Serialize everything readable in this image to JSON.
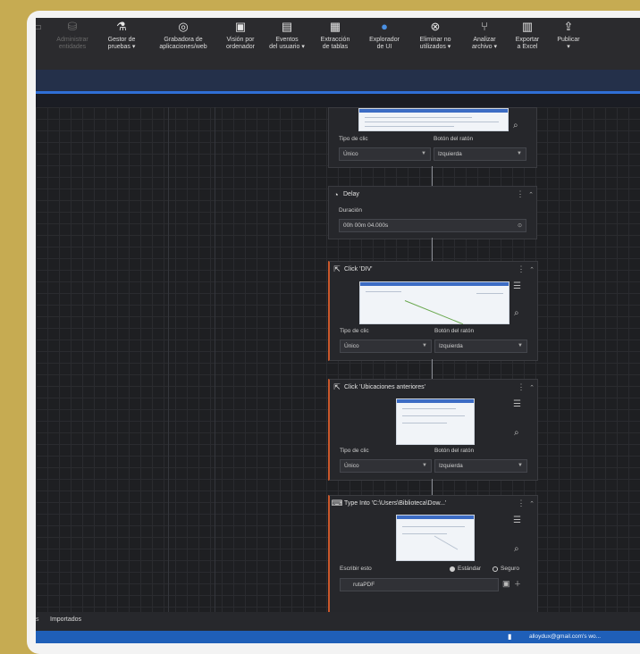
{
  "ribbon": {
    "items": [
      {
        "label1": "Administrar",
        "label2": "entidades",
        "icon": "database-icon",
        "enabled": false
      },
      {
        "label1": "Gestor de",
        "label2": "pruebas ▾",
        "icon": "flask-icon",
        "enabled": true
      },
      {
        "label1": "Grabadora de",
        "label2": "aplicaciones/web",
        "icon": "record-icon",
        "enabled": true
      },
      {
        "label1": "Visión por",
        "label2": "ordenador",
        "icon": "camera-icon",
        "enabled": true
      },
      {
        "label1": "Eventos",
        "label2": "del usuario ▾",
        "icon": "event-icon",
        "enabled": true
      },
      {
        "label1": "Extracción",
        "label2": "de tablas",
        "icon": "table-icon",
        "enabled": true
      },
      {
        "label1": "Explorador",
        "label2": "de UI",
        "icon": "globe-icon",
        "enabled": true
      },
      {
        "label1": "Eliminar no",
        "label2": "utilizados ▾",
        "icon": "remove-icon",
        "enabled": true
      },
      {
        "label1": "Analizar",
        "label2": "archivo ▾",
        "icon": "analyze-icon",
        "enabled": true
      },
      {
        "label1": "Exportar",
        "label2": "a Excel",
        "icon": "excel-icon",
        "enabled": true
      },
      {
        "label1": "Publicar",
        "label2": "▾",
        "icon": "upload-icon",
        "enabled": true
      }
    ]
  },
  "activities": {
    "click1": {
      "tipo_label": "Tipo de clic",
      "tipo_value": "Único",
      "boton_label": "Botón del ratón",
      "boton_value": "Izquierda"
    },
    "delay": {
      "title": "Delay",
      "duracion_label": "Duración",
      "duracion_value": "00h 00m 04.000s"
    },
    "click2": {
      "title": "Click 'DIV'",
      "tipo_label": "Tipo de clic",
      "tipo_value": "Único",
      "boton_label": "Botón del ratón",
      "boton_value": "Izquierda"
    },
    "click3": {
      "title": "Click 'Ubicaciones anteriores'",
      "tipo_label": "Tipo de clic",
      "tipo_value": "Único",
      "boton_label": "Botón del ratón",
      "boton_value": "Izquierda"
    },
    "typeinto": {
      "title": "Type Into 'C:\\Users\\Biblioteca\\Dow...'",
      "escribir_label": "Escribir esto",
      "radio1": "Estándar",
      "radio2": "Seguro",
      "value": "rutaPDF"
    }
  },
  "bottom": {
    "tab": "Importados",
    "status_user": "alloydux@gmail.com's wo..."
  },
  "colors": {
    "accent": "#2f6fd6",
    "status_bar": "#1f5fb8",
    "selected_edge": "#c9572b",
    "background": "#c6ab52"
  }
}
